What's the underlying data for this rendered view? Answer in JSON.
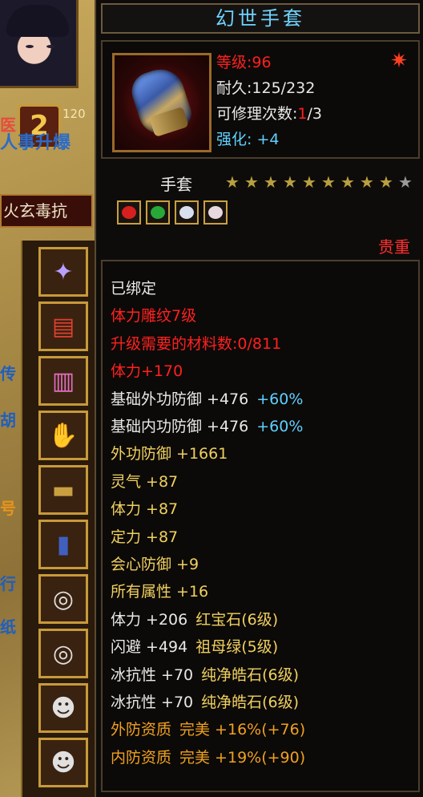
{
  "side": {
    "level_badge": "2",
    "fragment_a": "医",
    "fragment_b": "120",
    "blue_strip": "人事升爆",
    "buff_button": "火玄毒抗",
    "glyphs": [
      "传",
      "胡",
      "号",
      "行",
      "纸"
    ]
  },
  "equipment_slots": [
    {
      "icon": "bracelet-icon",
      "symbol": "✦"
    },
    {
      "icon": "scroll-icon",
      "symbol": "▤"
    },
    {
      "icon": "cuff-icon",
      "symbol": "▥"
    },
    {
      "icon": "gauntlet-icon",
      "symbol": "✋"
    },
    {
      "icon": "belt-icon",
      "symbol": "▬"
    },
    {
      "icon": "boots-icon",
      "symbol": "▮"
    },
    {
      "icon": "ring-icon",
      "symbol": "◎"
    },
    {
      "icon": "ring-icon",
      "symbol": "◎"
    },
    {
      "icon": "mask-icon",
      "symbol": "☻"
    },
    {
      "icon": "mask-icon",
      "symbol": "☻"
    }
  ],
  "item": {
    "name": "幻世手套",
    "icon": "gauntlet-icon",
    "level_label": "等级:96",
    "durability_label": "耐久:125/232",
    "repair_prefix": "可修理次数:",
    "repair_used": "1",
    "repair_total": "/3",
    "enhance_label": "强化:",
    "enhance_value": "+4",
    "corner_icon": "flame-icon",
    "type": "手套",
    "stars_filled": 9,
    "stars_total": 10,
    "gems": [
      {
        "color": "#d62020",
        "name": "ruby"
      },
      {
        "color": "#28a838",
        "name": "emerald"
      },
      {
        "color": "#d8e0f0",
        "name": "crystal"
      },
      {
        "color": "#e8d8e0",
        "name": "crystal"
      }
    ],
    "rarity": "贵重"
  },
  "stats": [
    {
      "parts": [
        {
          "text": "已绑定",
          "color": "#e8e8e8"
        }
      ]
    },
    {
      "parts": [
        {
          "text": "体力雕纹7级",
          "color": "#ff2020"
        }
      ]
    },
    {
      "parts": [
        {
          "text": "升级需要的材料数:0/811",
          "color": "#ff2020"
        }
      ]
    },
    {
      "parts": [
        {
          "text": "体力+170",
          "color": "#ff2020"
        }
      ]
    },
    {
      "parts": [
        {
          "text": "基础外功防御 +476",
          "color": "#e8e8e8"
        },
        {
          "text": "+60%",
          "color": "#5fd0ff"
        }
      ]
    },
    {
      "parts": [
        {
          "text": "基础内功防御 +476",
          "color": "#e8e8e8"
        },
        {
          "text": "+60%",
          "color": "#5fd0ff"
        }
      ]
    },
    {
      "parts": [
        {
          "text": "外功防御 +1661",
          "color": "#f0d060"
        }
      ]
    },
    {
      "parts": [
        {
          "text": "灵气 +87",
          "color": "#f0d060"
        }
      ]
    },
    {
      "parts": [
        {
          "text": "体力 +87",
          "color": "#f0d060"
        }
      ]
    },
    {
      "parts": [
        {
          "text": "定力 +87",
          "color": "#f0d060"
        }
      ]
    },
    {
      "parts": [
        {
          "text": "会心防御 +9",
          "color": "#f0d060"
        }
      ]
    },
    {
      "parts": [
        {
          "text": "所有属性 +16",
          "color": "#f0d060"
        }
      ]
    },
    {
      "parts": [
        {
          "text": "体力 +206",
          "color": "#e8e8e8"
        },
        {
          "text": "红宝石(6级)",
          "color": "#f0d060"
        }
      ]
    },
    {
      "parts": [
        {
          "text": "闪避 +494",
          "color": "#e8e8e8"
        },
        {
          "text": "祖母绿(5级)",
          "color": "#f0d060"
        }
      ]
    },
    {
      "parts": [
        {
          "text": "冰抗性 +70",
          "color": "#e8e8e8"
        },
        {
          "text": "纯净皓石(6级)",
          "color": "#f0d060"
        }
      ]
    },
    {
      "parts": [
        {
          "text": "冰抗性 +70",
          "color": "#e8e8e8"
        },
        {
          "text": "纯净皓石(6级)",
          "color": "#f0d060"
        }
      ]
    },
    {
      "parts": [
        {
          "text": "外防资质",
          "color": "#f0a020"
        },
        {
          "text": "完美 +16%(+76)",
          "color": "#f0a020"
        }
      ]
    },
    {
      "parts": [
        {
          "text": "内防资质",
          "color": "#f0a020"
        },
        {
          "text": "完美 +19%(+90)",
          "color": "#f0a020"
        }
      ]
    }
  ]
}
